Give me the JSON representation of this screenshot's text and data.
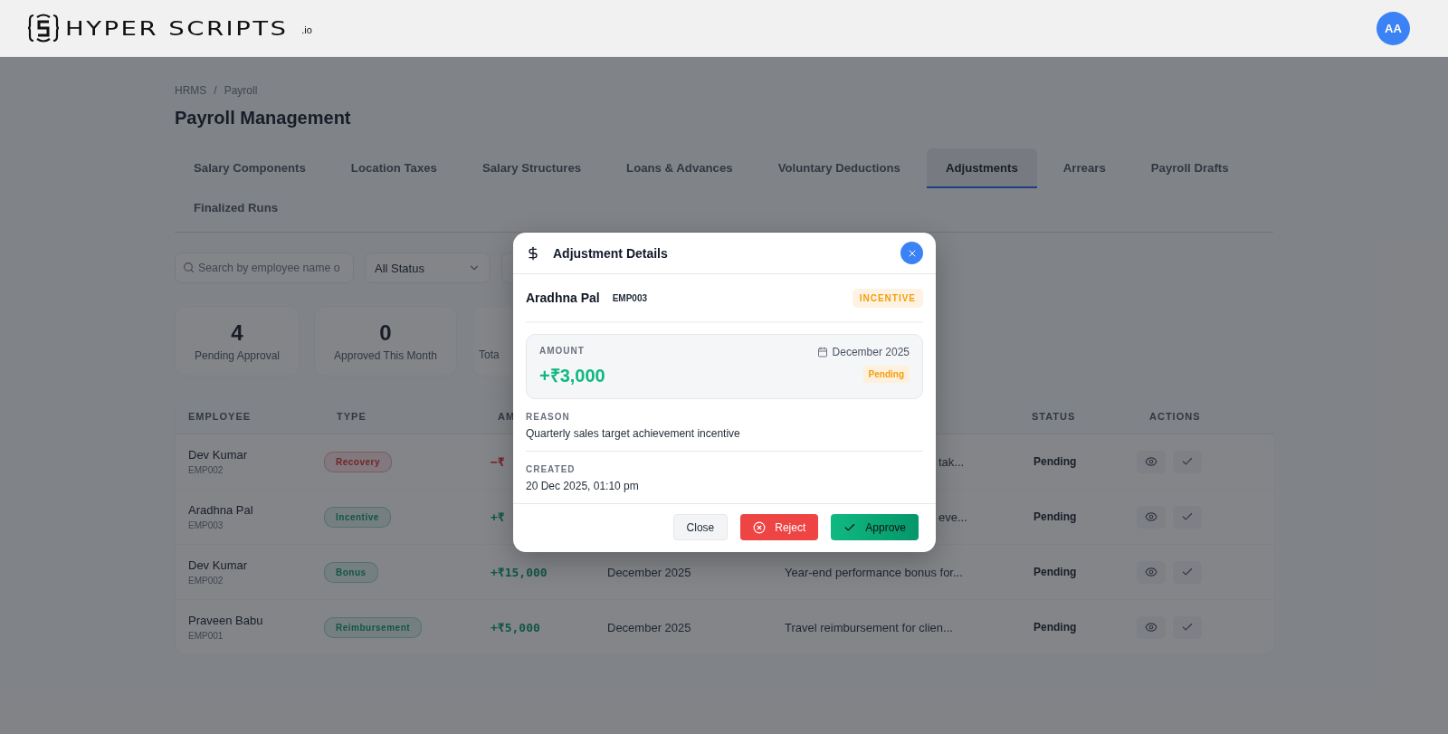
{
  "header": {
    "logo": {
      "name": "HYPER SCRIPTS",
      "suffix": ".io"
    },
    "avatar": "AA"
  },
  "breadcrumb": {
    "items": [
      "HRMS",
      "Payroll"
    ],
    "separator": "/"
  },
  "title": "Payroll Management",
  "tabs": [
    {
      "label": "Salary Components",
      "selected": false
    },
    {
      "label": "Location Taxes",
      "selected": false
    },
    {
      "label": "Salary Structures",
      "selected": false
    },
    {
      "label": "Loans & Advances",
      "selected": false
    },
    {
      "label": "Voluntary Deductions",
      "selected": false
    },
    {
      "label": "Adjustments",
      "selected": true
    },
    {
      "label": "Arrears",
      "selected": false
    },
    {
      "label": "Payroll Drafts",
      "selected": false
    },
    {
      "label": "Finalized Runs",
      "selected": false
    }
  ],
  "filters": {
    "search_placeholder": "Search by employee name o",
    "status": "All Status"
  },
  "stats": [
    {
      "value": "4",
      "label": "Pending Approval",
      "covered": false
    },
    {
      "value": "0",
      "label": "Approved This Month",
      "covered": false
    },
    {
      "label": "Tota",
      "covered": true
    }
  ],
  "table": {
    "columns": [
      "EMPLOYEE",
      "TYPE",
      "AM",
      "STATUS",
      "ACTIONS"
    ],
    "rows": [
      {
        "name": "Dev Kumar",
        "id": "EMP002",
        "type": {
          "label": "Recovery",
          "kind": "debit"
        },
        "amount": "−₹",
        "reason": "tak...",
        "status": "Pending",
        "covered": true
      },
      {
        "name": "Aradhna Pal",
        "id": "EMP003",
        "type": {
          "label": "Incentive",
          "kind": "credit"
        },
        "amount": "+₹",
        "reason": "eve...",
        "status": "Pending",
        "covered": true
      },
      {
        "name": "Dev Kumar",
        "id": "EMP002",
        "type": {
          "label": "Bonus",
          "kind": "credit"
        },
        "amount": "+₹15,000",
        "month": "December 2025",
        "reason": "Year-end performance bonus for...",
        "status": "Pending",
        "covered": false
      },
      {
        "name": "Praveen Babu",
        "id": "EMP001",
        "type": {
          "label": "Reimbursement",
          "kind": "credit"
        },
        "amount": "+₹5,000",
        "month": "December 2025",
        "reason": "Travel reimbursement for clien...",
        "status": "Pending",
        "covered": false
      }
    ]
  },
  "modal": {
    "title": "Adjustment Details",
    "employee": "Aradhna Pal",
    "employee_id": "EMP003",
    "type_badge": "INCENTIVE",
    "amount_label": "AMOUNT",
    "amount": "+₹3,000",
    "month": "December 2025",
    "status": "Pending",
    "reason_label": "REASON",
    "reason": "Quarterly sales target achievement incentive",
    "created_label": "CREATED",
    "created": "20 Dec 2025, 01:10 pm",
    "buttons": [
      {
        "kind": "close",
        "label": "Close"
      },
      {
        "kind": "reject",
        "label": "Reject"
      },
      {
        "kind": "approve",
        "label": "Approve"
      }
    ]
  }
}
